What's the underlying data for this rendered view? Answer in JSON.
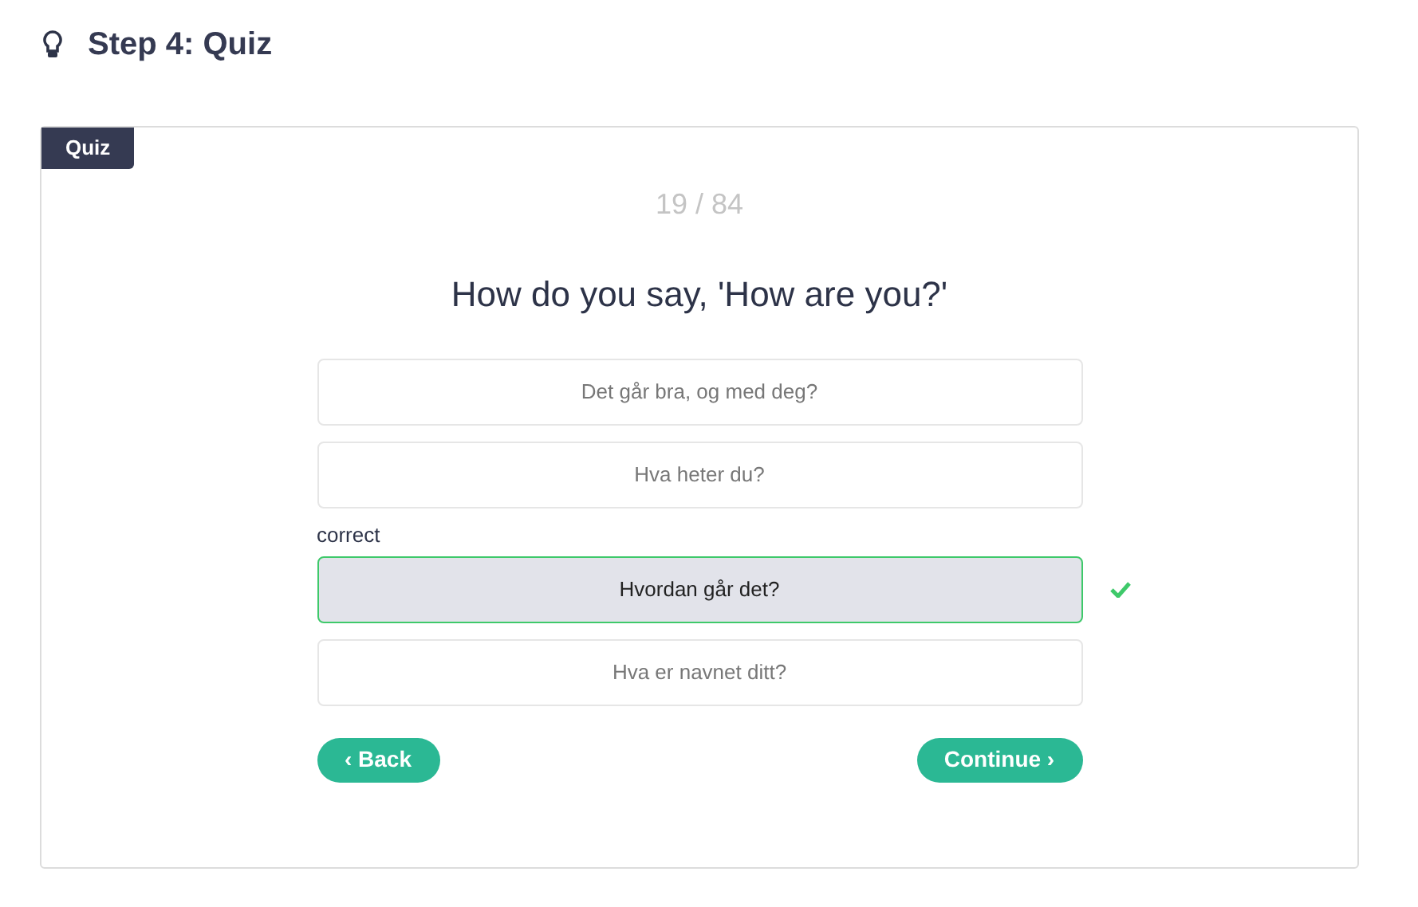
{
  "header": {
    "title": "Step 4: Quiz"
  },
  "card": {
    "tag": "Quiz",
    "counter": "19 / 84",
    "question": "How do you say, 'How are you?'",
    "options": [
      {
        "text": "Det går bra, og med deg?",
        "selected": false
      },
      {
        "text": "Hva heter du?",
        "selected": false
      },
      {
        "text": "Hvordan går det?",
        "selected": true,
        "feedback": "correct"
      },
      {
        "text": "Hva er navnet ditt?",
        "selected": false
      }
    ],
    "back_button": "‹ Back",
    "continue_button": "Continue ›"
  }
}
